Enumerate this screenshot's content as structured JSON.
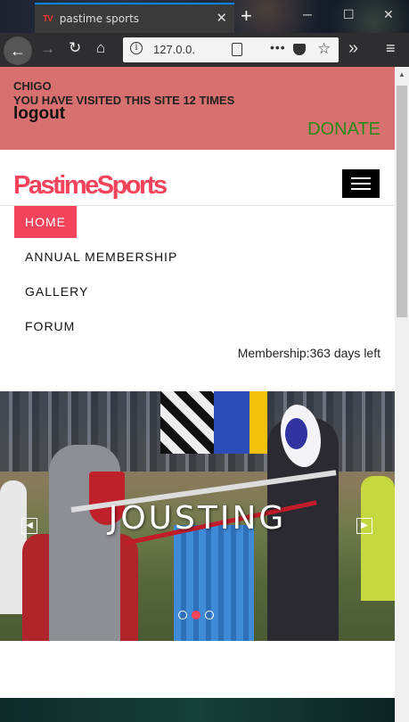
{
  "browser": {
    "tab_title": "pastime sports",
    "favicon_text": "TV",
    "url": "127.0.0.",
    "window_controls": [
      "minimize-icon",
      "maximize-icon",
      "close-icon"
    ]
  },
  "topbar": {
    "username": "CHIGO",
    "visits_text": "YOU HAVE VISITED THIS SITE 12 TIMES",
    "logout_label": "logout",
    "donate_label": "DONATE"
  },
  "brand": {
    "name": "PastimeSports",
    "color": "#f4445c"
  },
  "menu": {
    "items": [
      {
        "label": "HOME",
        "active": true
      },
      {
        "label": "ANNUAL MEMBERSHIP",
        "active": false
      },
      {
        "label": "GALLERY",
        "active": false
      },
      {
        "label": "FORUM",
        "active": false
      }
    ]
  },
  "membership_text": "Membership:363 days left",
  "carousel": {
    "caption": "JOUSTING",
    "slide_count": 3,
    "active_slide": 2
  },
  "colors": {
    "topbar_bg": "#d87070",
    "donate": "#2c8a1a",
    "accent": "#f4445c"
  }
}
